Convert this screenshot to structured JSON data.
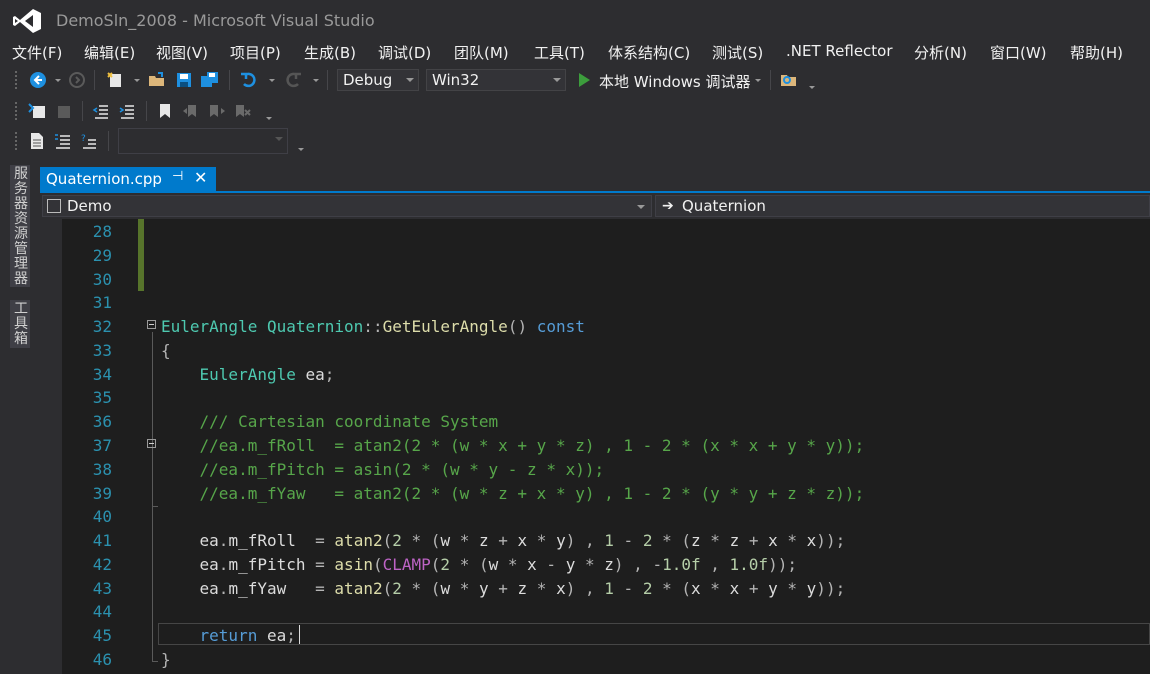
{
  "window": {
    "title": "DemoSln_2008 - Microsoft Visual Studio"
  },
  "menu": [
    "文件(F)",
    "编辑(E)",
    "视图(V)",
    "项目(P)",
    "生成(B)",
    "调试(D)",
    "团队(M)",
    "工具(T)",
    "体系结构(C)",
    "测试(S)",
    ".NET Reflector",
    "分析(N)",
    "窗口(W)",
    "帮助(H)"
  ],
  "toolbar": {
    "config": "Debug",
    "platform": "Win32",
    "debugger_label": "本地 Windows 调试器"
  },
  "side_tabs": [
    "服务器资源管理器",
    "工具箱"
  ],
  "doc_tab": {
    "label": "Quaternion.cpp"
  },
  "nav": {
    "project": "Demo",
    "scope": "Quaternion"
  },
  "colors": {
    "accent": "#007acc",
    "editor_bg": "#1e1e1e",
    "changed_bar": "#57742b"
  },
  "code_lines": [
    {
      "num": "28",
      "text": ""
    },
    {
      "num": "29",
      "text": ""
    },
    {
      "num": "30",
      "text": ""
    },
    {
      "num": "31",
      "text": ""
    },
    {
      "num": "32",
      "text": "EulerAngle Quaternion::GetEulerAngle() const"
    },
    {
      "num": "33",
      "text": "{"
    },
    {
      "num": "34",
      "text": "    EulerAngle ea;"
    },
    {
      "num": "35",
      "text": ""
    },
    {
      "num": "36",
      "text": "    /// Cartesian coordinate System"
    },
    {
      "num": "37",
      "text": "    //ea.m_fRoll  = atan2(2 * (w * x + y * z) , 1 - 2 * (x * x + y * y));"
    },
    {
      "num": "38",
      "text": "    //ea.m_fPitch = asin(2 * (w * y - z * x));"
    },
    {
      "num": "39",
      "text": "    //ea.m_fYaw   = atan2(2 * (w * z + x * y) , 1 - 2 * (y * y + z * z));"
    },
    {
      "num": "40",
      "text": ""
    },
    {
      "num": "41",
      "text": "    ea.m_fRoll  = atan2(2 * (w * z + x * y) , 1 - 2 * (z * z + x * x));"
    },
    {
      "num": "42",
      "text": "    ea.m_fPitch = asin(CLAMP(2 * (w * x - y * z) , -1.0f , 1.0f));"
    },
    {
      "num": "43",
      "text": "    ea.m_fYaw   = atan2(2 * (w * y + z * x) , 1 - 2 * (x * x + y * y));"
    },
    {
      "num": "44",
      "text": ""
    },
    {
      "num": "45",
      "text": "    return ea;"
    },
    {
      "num": "46",
      "text": "}"
    }
  ]
}
